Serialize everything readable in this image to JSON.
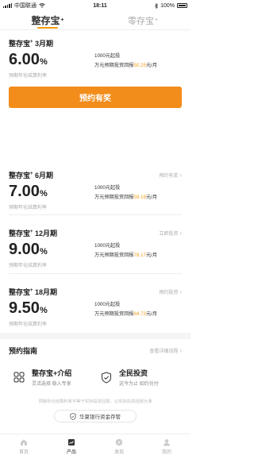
{
  "status_bar": {
    "carrier": "中国联通",
    "time": "18:11",
    "battery": "100%"
  },
  "tabs": [
    {
      "label": "整存宝",
      "sup": "+",
      "active": true
    },
    {
      "label": "零存宝",
      "sup": "+",
      "active": false
    }
  ],
  "products": [
    {
      "name": "整存宝",
      "sup": "+",
      "term": "3月期",
      "action": "",
      "rate": "6.00",
      "rate_unit": "%",
      "rate_label": "预期年化结算利率",
      "min_invest": "1000元起投",
      "return_prefix": "万元预期投资回报",
      "return_value": "50.25",
      "return_suffix": "元/月",
      "cta": "预约有奖"
    },
    {
      "name": "整存宝",
      "sup": "+",
      "term": "6月期",
      "action": "预约有奖",
      "rate": "7.00",
      "rate_unit": "%",
      "rate_label": "预期年化结算利率",
      "min_invest": "1000元起投",
      "return_prefix": "万元预期投资回报",
      "return_value": "59.19",
      "return_suffix": "元/月"
    },
    {
      "name": "整存宝",
      "sup": "+",
      "term": "12月期",
      "action": "立即投资",
      "rate": "9.00",
      "rate_unit": "%",
      "rate_label": "预期年化结算利率",
      "min_invest": "1000元起投",
      "return_prefix": "万元预期投资回报",
      "return_value": "78.17",
      "return_suffix": "元/月"
    },
    {
      "name": "整存宝",
      "sup": "+",
      "term": "18月期",
      "action": "预约投资",
      "rate": "9.50",
      "rate_unit": "%",
      "rate_label": "预期年化结算利率",
      "min_invest": "1000元起投",
      "return_prefix": "万元预期投资回报",
      "return_value": "84.73",
      "return_suffix": "元/月"
    }
  ],
  "guide": {
    "title": "预约指南",
    "link": "查看详细流程",
    "items": [
      {
        "title": "整存宝+介绍",
        "sub": "灵活选择 稳入专享",
        "icon": "grid-icon"
      },
      {
        "title": "全民投资",
        "sub": "这今为止 如约兑付",
        "icon": "shield-icon"
      }
    ]
  },
  "disclaimer": "预期年化结算利率不等于实际投资回报，以实际投资回报为准",
  "bank_badge": "华夏银行资金存管",
  "bottom_nav": [
    {
      "label": "首页",
      "icon": "home-icon",
      "active": false
    },
    {
      "label": "产品",
      "icon": "product-icon",
      "active": true
    },
    {
      "label": "发现",
      "icon": "compass-icon",
      "active": false
    },
    {
      "label": "我的",
      "icon": "user-icon",
      "active": false
    }
  ],
  "colors": {
    "accent": "#f28c1a",
    "highlight": "#f39c12"
  }
}
